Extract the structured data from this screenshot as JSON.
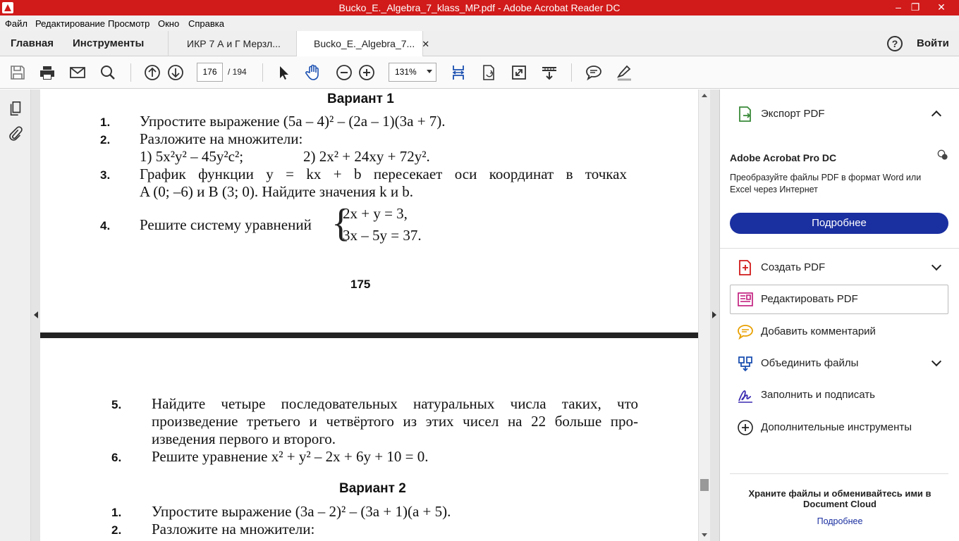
{
  "window": {
    "title": "Bucko_E._Algebra_7_klass_MP.pdf - Adobe Acrobat Reader DC",
    "minimize": "–",
    "restore": "❐",
    "close": "✕"
  },
  "menu": [
    "Файл",
    "Редактирование",
    "Просмотр",
    "Окно",
    "Справка"
  ],
  "nav": {
    "home": "Главная",
    "tools": "Инструменты",
    "tab1": "ИКР 7 А и Г Мерзл...",
    "tab2": "Bucko_E._Algebra_7...",
    "tab2_close": "✕",
    "help": "?",
    "signin": "Войти"
  },
  "toolbar": {
    "page_current": "176",
    "page_total": "/ 194",
    "zoom": "131%"
  },
  "document": {
    "v1_heading": "Вариант 1",
    "n1": "1.",
    "t1": "Упростите выражение (5a – 4)² – (2a – 1)(3a + 7).",
    "n2": "2.",
    "t2a": "Разложите на множители:",
    "t2b": "1) 5x²y² – 45y²c²;",
    "t2c": "2) 2x² + 24xy + 72y².",
    "n3": "3.",
    "t3a": "График функции y = kx + b пересекает оси координат в точках",
    "t3b": "A (0; –6) и B (3; 0). Найдите значения k и b.",
    "n4": "4.",
    "t4": "Решите систему уравнений",
    "t4e1": "2x + y = 3,",
    "t4e2": "3x – 5y = 37.",
    "page_number": "175",
    "n5": "5.",
    "t5a": "Найдите четыре последовательных натуральных числа таких, что",
    "t5b": "произведение третьего и четвёртого из этих чисел на 22 больше про-",
    "t5c": "изведения первого и второго.",
    "n6": "6.",
    "t6": "Решите уравнение x² + y² – 2x + 6y + 10 = 0.",
    "v2_heading": "Вариант 2",
    "m1": "1.",
    "u1": "Упростите выражение (3a – 2)² – (3a + 1)(a + 5).",
    "m2": "2.",
    "u2": "Разложите на множители:"
  },
  "panel": {
    "export": "Экспорт PDF",
    "promo_title": "Adobe Acrobat Pro DC",
    "promo_text": "Преобразуйте файлы PDF в формат Word или Excel через Интернет",
    "promo_button": "Подробнее",
    "create": "Создать PDF",
    "edit": "Редактировать PDF",
    "comment": "Добавить комментарий",
    "combine": "Объединить файлы",
    "fill": "Заполнить и подписать",
    "more": "Дополнительные инструменты",
    "cloud_text": "Храните файлы и обменивайтесь ими в Document Cloud",
    "cloud_link": "Подробнее"
  }
}
